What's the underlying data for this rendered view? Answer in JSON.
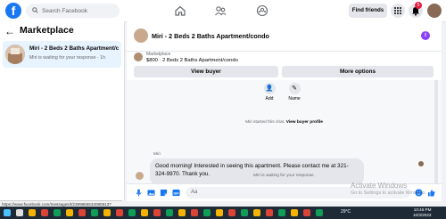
{
  "topbar": {
    "logo": "f",
    "search_placeholder": "Search Facebook",
    "find_friends": "Find friends",
    "notification_count": "5"
  },
  "sidebar": {
    "title": "Marketplace",
    "conversation": {
      "title": "Miri - 2 Beds 2 Baths Apartment/c...",
      "subtitle": "Miri is waiting for your response · 1h"
    }
  },
  "chat": {
    "header_title": "Miri - 2 Beds 2 Baths Apartment/condo",
    "listing": {
      "label": "Marketplace",
      "price_title": "$800 · 2 Beds 2 Baths Apartment/condo"
    },
    "buttons": {
      "view_buyer": "View buyer",
      "more_options": "More options"
    },
    "quick_actions": [
      {
        "label": "Add",
        "icon": "add-person-icon",
        "glyph": "👤"
      },
      {
        "label": "Name",
        "icon": "pencil-icon",
        "glyph": "✎"
      }
    ],
    "system_started_prefix": "Miri started this chat.",
    "system_started_link": "View buyer profile",
    "sender_name": "Miri",
    "message": "Good morning! Interested in seeing this apartment. Please contact me at 321-324-9970. Thank you.",
    "waiting_note": "Miri is waiting for your response.",
    "compose_placeholder": "Aa"
  },
  "status_url": "https://www.facebook.com/messages/t/2399855533080613?",
  "watermark": {
    "line1": "Activate Windows",
    "line2": "Go to Settings to activate Windows."
  },
  "taskbar": {
    "weather": "29°C",
    "time": "10:46 PM",
    "date": "10/3/2023"
  },
  "colors": {
    "brand": "#1877f2",
    "selected_bg": "#e7f3ff",
    "bubble_bg": "#e4e6eb",
    "badge": "#e41e3f"
  }
}
